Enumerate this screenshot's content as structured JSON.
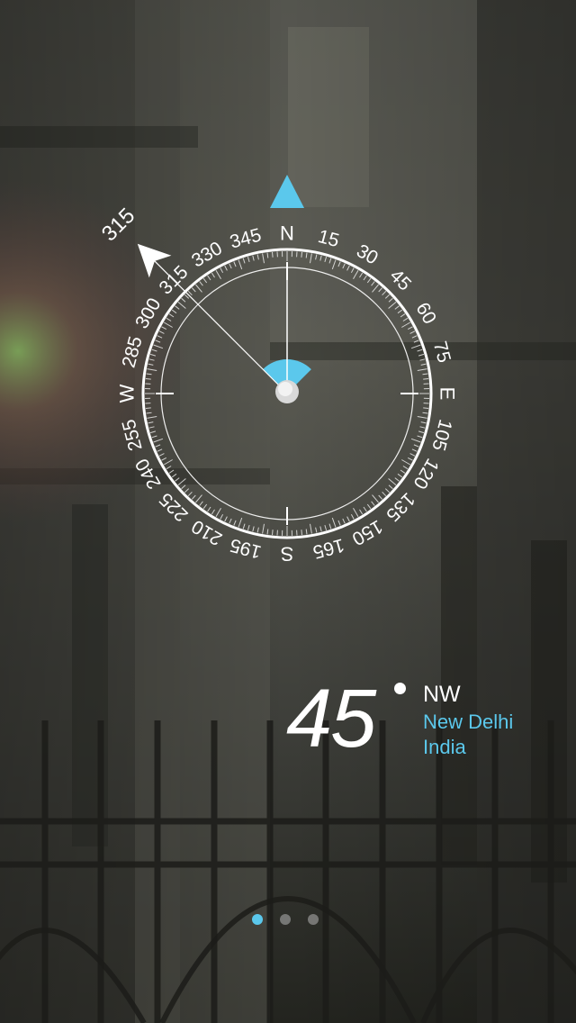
{
  "compass": {
    "heading_label": "315",
    "labels": [
      "N",
      "15",
      "30",
      "45",
      "60",
      "75",
      "E",
      "105",
      "120",
      "135",
      "150",
      "165",
      "S",
      "195",
      "210",
      "225",
      "240",
      "255",
      "W",
      "285",
      "300",
      "315",
      "330",
      "345"
    ],
    "accent_color": "#5bc8ec"
  },
  "reading": {
    "degrees": "45",
    "direction": "NW",
    "city": "New Delhi",
    "country": "India"
  },
  "pager": {
    "count": 3,
    "active_index": 0
  },
  "icons": {
    "north_marker": "north-triangle-icon",
    "heading_marker": "heading-arrow-icon"
  }
}
